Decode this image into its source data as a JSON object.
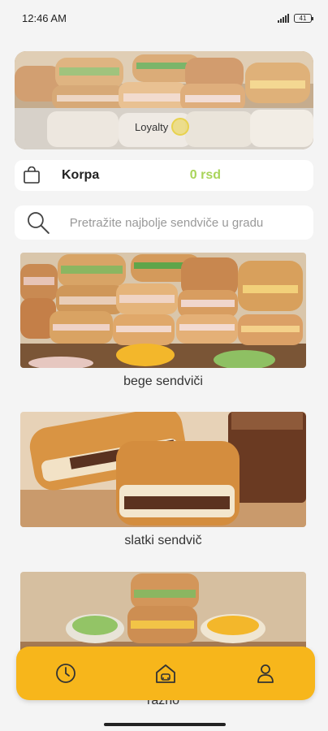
{
  "status_bar": {
    "time": "12:46 AM",
    "battery": "41"
  },
  "hero": {
    "loyalty_label": "Loyalty"
  },
  "cart": {
    "label": "Korpa",
    "total": "0 rsd"
  },
  "search": {
    "placeholder": "Pretražite najbolje sendviče u gradu"
  },
  "categories": [
    {
      "label": "bege sendviči"
    },
    {
      "label": "slatki sendvič"
    },
    {
      "label": "razno"
    }
  ],
  "bottom_nav": {
    "items": [
      {
        "icon": "clock-icon"
      },
      {
        "icon": "home-icon"
      },
      {
        "icon": "profile-icon"
      }
    ]
  },
  "colors": {
    "accent": "#f7b61b",
    "price": "#a9d45a",
    "background": "#f4f4f4"
  }
}
